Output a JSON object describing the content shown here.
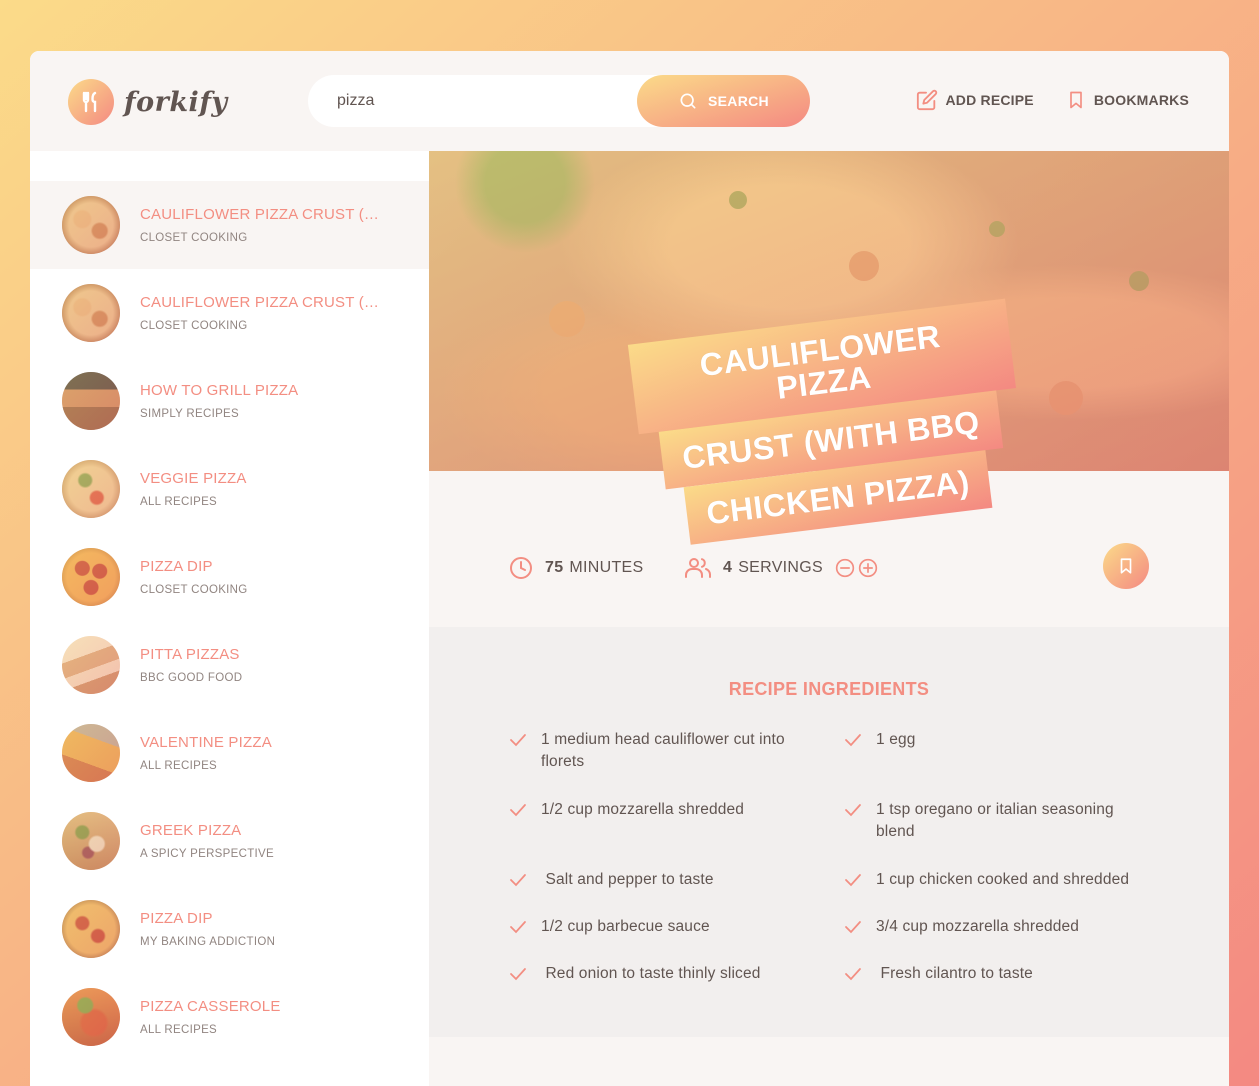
{
  "app": {
    "name": "forkify"
  },
  "header": {
    "search_value": "pizza",
    "search_button": "SEARCH",
    "add_recipe": "ADD RECIPE",
    "bookmarks": "BOOKMARKS"
  },
  "results": [
    {
      "title": "CAULIFLOWER PIZZA CRUST (WIT...",
      "publisher": "CLOSET COOKING",
      "active": true
    },
    {
      "title": "CAULIFLOWER PIZZA CRUST (WIT...",
      "publisher": "CLOSET COOKING"
    },
    {
      "title": "HOW TO GRILL PIZZA",
      "publisher": "SIMPLY RECIPES"
    },
    {
      "title": "VEGGIE PIZZA",
      "publisher": "ALL RECIPES"
    },
    {
      "title": "PIZZA DIP",
      "publisher": "CLOSET COOKING"
    },
    {
      "title": "PITTA PIZZAS",
      "publisher": "BBC GOOD FOOD"
    },
    {
      "title": "VALENTINE PIZZA",
      "publisher": "ALL RECIPES"
    },
    {
      "title": "GREEK PIZZA",
      "publisher": "A SPICY PERSPECTIVE"
    },
    {
      "title": "PIZZA DIP",
      "publisher": "MY BAKING ADDICTION"
    },
    {
      "title": "PIZZA CASSEROLE",
      "publisher": "ALL RECIPES"
    }
  ],
  "recipe": {
    "title_lines": [
      "CAULIFLOWER PIZZA",
      "CRUST (WITH BBQ",
      "CHICKEN PIZZA)"
    ],
    "cooking_time": "75",
    "cooking_time_unit": "MINUTES",
    "servings": "4",
    "servings_unit": "SERVINGS",
    "ingredients_heading": "RECIPE INGREDIENTS",
    "ingredients": [
      "1 medium head cauliflower cut into florets",
      "1 egg",
      "1/2 cup mozzarella shredded",
      "1 tsp oregano or italian seasoning blend",
      " Salt and pepper to taste",
      "1 cup chicken cooked and shredded",
      "1/2 cup barbecue sauce",
      "3/4 cup mozzarella shredded",
      " Red onion to taste thinly sliced",
      " Fresh cilantro to taste"
    ]
  },
  "colors": {
    "accent": "#f38e82",
    "gradient_start": "#fbdb89",
    "gradient_end": "#f48982",
    "text": "#615551",
    "light_bg": "#f9f5f3"
  },
  "icons": [
    "utensils-icon",
    "search-icon",
    "edit-icon",
    "bookmark-icon",
    "clock-icon",
    "users-icon",
    "minus-circle-icon",
    "plus-circle-icon",
    "check-icon"
  ]
}
